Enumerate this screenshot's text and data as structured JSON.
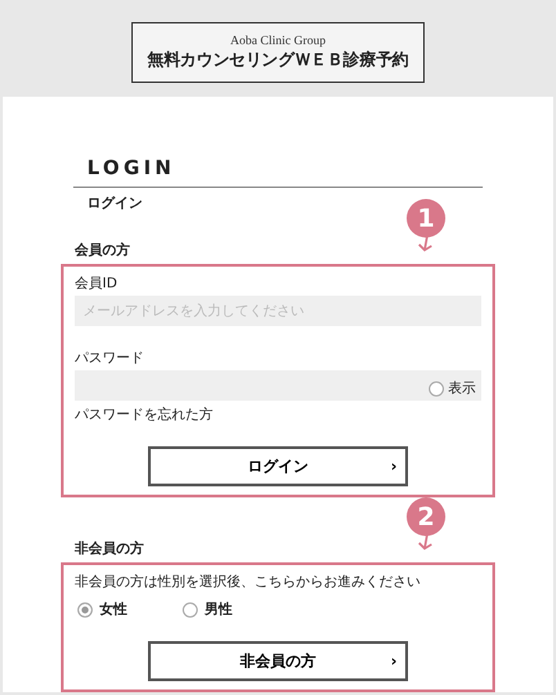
{
  "header": {
    "group_name": "Aoba Clinic Group",
    "title": "無料カウンセリングＷＥＢ診療予約"
  },
  "login": {
    "heading": "LOGIN",
    "subheading": "ログイン"
  },
  "member": {
    "badge": "1",
    "heading": "会員の方",
    "id_field": {
      "label": "会員ID",
      "placeholder": "メールアドレスを入力してください"
    },
    "password_field": {
      "label": "パスワード",
      "show_label": "表示",
      "show_checked": false
    },
    "forgot_link": "パスワードを忘れた方",
    "button": {
      "label": "ログイン",
      "chevron": "›"
    }
  },
  "nonmember": {
    "badge": "2",
    "heading": "非会員の方",
    "instruction": "非会員の方は性別を選択後、こちらからお進みください",
    "genders": [
      {
        "label": "女性",
        "selected": true
      },
      {
        "label": "男性",
        "selected": false
      }
    ],
    "button": {
      "label": "非会員の方",
      "chevron": "›"
    }
  }
}
